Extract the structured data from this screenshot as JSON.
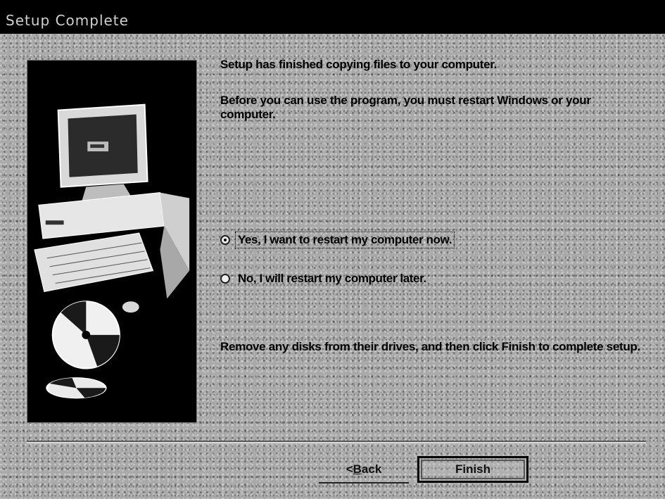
{
  "window": {
    "title": "Setup Complete"
  },
  "messages": {
    "finished": "Setup has finished copying files to your computer.",
    "restart_required": "Before you can use the program, you must restart Windows or your computer.",
    "instructions": "Remove any disks from their drives, and then click Finish to complete setup."
  },
  "options": {
    "selected": "restart_now",
    "restart_now_label": "Yes, I want to restart my computer now.",
    "restart_later_label": "No, I will restart my computer later."
  },
  "buttons": {
    "back_prefix": "< ",
    "back_mnemonic": "B",
    "back_rest": "ack",
    "finish_label": "Finish"
  },
  "illustration": {
    "icon": "computer-with-discs-icon"
  }
}
